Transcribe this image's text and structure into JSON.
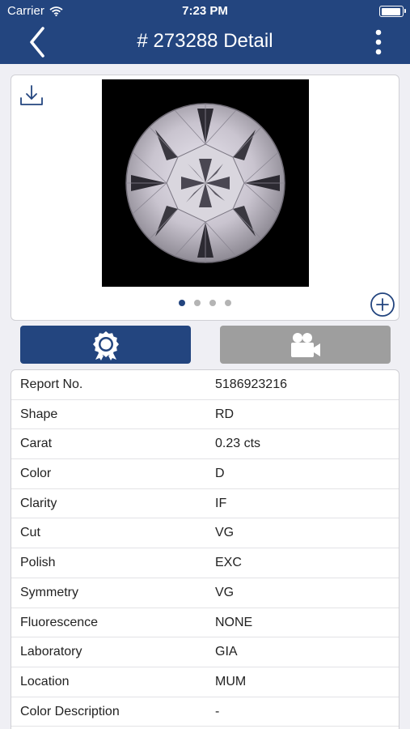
{
  "status_bar": {
    "carrier": "Carrier",
    "time": "7:23 PM"
  },
  "nav": {
    "title": "# 273288 Detail"
  },
  "gallery": {
    "page_count": 4,
    "active_index": 0
  },
  "details": [
    {
      "label": "Report No.",
      "value": "5186923216"
    },
    {
      "label": "Shape",
      "value": "RD"
    },
    {
      "label": "Carat",
      "value": "0.23 cts"
    },
    {
      "label": "Color",
      "value": "D"
    },
    {
      "label": "Clarity",
      "value": "IF"
    },
    {
      "label": "Cut",
      "value": "VG"
    },
    {
      "label": "Polish",
      "value": "EXC"
    },
    {
      "label": "Symmetry",
      "value": "VG"
    },
    {
      "label": "Fluorescence",
      "value": "NONE"
    },
    {
      "label": "Laboratory",
      "value": "GIA"
    },
    {
      "label": "Location",
      "value": "MUM"
    },
    {
      "label": "Color Description",
      "value": "-"
    }
  ],
  "colors": {
    "primary": "#23457f",
    "inactive_button": "#9e9e9e",
    "background": "#efeff4",
    "dot_inactive": "#b4b4b4"
  },
  "icons": {
    "back": "chevron-left-icon",
    "more": "more-vertical-icon",
    "download": "download-icon",
    "zoom": "plus-circle-icon",
    "certificate": "certificate-badge-icon",
    "video": "video-camera-icon"
  }
}
